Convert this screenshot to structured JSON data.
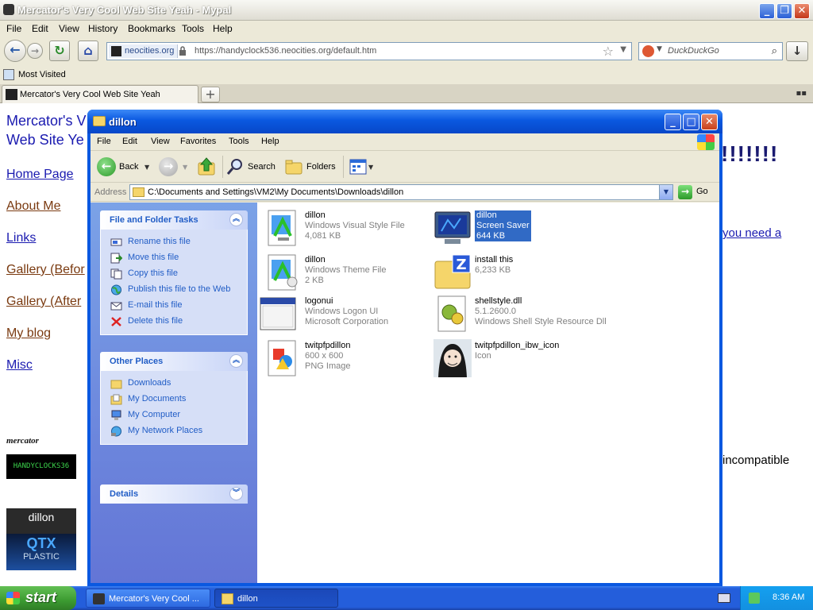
{
  "browser": {
    "title": "Mercator's Very Cool Web Site Yeah - Mypal",
    "menu": [
      "File",
      "Edit",
      "View",
      "History",
      "Bookmarks",
      "Tools",
      "Help"
    ],
    "site_identity": "neocities.org",
    "url": "https://handyclock536.neocities.org/default.htm",
    "search_placeholder": "DuckDuckGo",
    "bookmarks": [
      "Most Visited"
    ],
    "tab_title": "Mercator's Very Cool Web Site Yeah",
    "new_tab": "+"
  },
  "page": {
    "site_title_1": "Mercator's V",
    "site_title_2": "Web Site Ye",
    "nav": [
      {
        "label": "Home Page",
        "visited": false
      },
      {
        "label": "About Me",
        "visited": true
      },
      {
        "label": "Links",
        "visited": false
      },
      {
        "label": "Gallery (Befor",
        "visited": true
      },
      {
        "label": "Gallery (After",
        "visited": true
      },
      {
        "label": "My blog",
        "visited": true
      },
      {
        "label": "Misc",
        "visited": false
      }
    ],
    "exclaim": "!!!!!!!",
    "right_link": "you need a",
    "right_text": "incompatible",
    "badges": {
      "mercator": "mercator",
      "handyclocks": "HANDYCLOCKS36",
      "dillon": "dillon",
      "qtx": "QTX",
      "plastic": "PLASTIC"
    }
  },
  "explorer": {
    "title": "dillon",
    "menu": [
      "File",
      "Edit",
      "View",
      "Favorites",
      "Tools",
      "Help"
    ],
    "toolbar": {
      "back": "Back",
      "search": "Search",
      "folders": "Folders"
    },
    "address_label": "Address",
    "address": "C:\\Documents and Settings\\VM2\\My Documents\\Downloads\\dillon",
    "go": "Go",
    "panels": {
      "tasks": {
        "title": "File and Folder Tasks",
        "items": [
          "Rename this file",
          "Move this file",
          "Copy this file",
          "Publish this file to the Web",
          "E-mail this file",
          "Delete this file"
        ]
      },
      "places": {
        "title": "Other Places",
        "items": [
          "Downloads",
          "My Documents",
          "My Computer",
          "My Network Places"
        ]
      },
      "details": {
        "title": "Details"
      }
    },
    "files": [
      {
        "name": "dillon",
        "line2": "Windows Visual Style File",
        "line3": "4,081 KB",
        "icon": "visual-style-icon",
        "selected": false
      },
      {
        "name": "dillon",
        "line2": "Screen Saver",
        "line3": "644 KB",
        "icon": "screen-saver-icon",
        "selected": true
      },
      {
        "name": "dillon",
        "line2": "Windows Theme File",
        "line3": "2 KB",
        "icon": "theme-file-icon",
        "selected": false
      },
      {
        "name": "install this",
        "line2": "6,233 KB",
        "line3": "",
        "icon": "zip-folder-icon",
        "selected": false
      },
      {
        "name": "logonui",
        "line2": "Windows Logon UI",
        "line3": "Microsoft Corporation",
        "icon": "exe-window-icon",
        "selected": false
      },
      {
        "name": "shellstyle.dll",
        "line2": "5.1.2600.0",
        "line3": "Windows Shell Style Resource Dll",
        "icon": "dll-icon",
        "selected": false
      },
      {
        "name": "twitpfpdillon",
        "line2": "600 x 600",
        "line3": "PNG Image",
        "icon": "png-image-icon",
        "selected": false
      },
      {
        "name": "twitpfpdillon_ibw_icon",
        "line2": "Icon",
        "line3": "",
        "icon": "avatar-icon",
        "selected": false
      }
    ]
  },
  "taskbar": {
    "start": "start",
    "tasks": [
      {
        "label": "Mercator's Very Cool ...",
        "active": false
      },
      {
        "label": "dillon",
        "active": true
      }
    ],
    "clock": "8:36 AM"
  }
}
